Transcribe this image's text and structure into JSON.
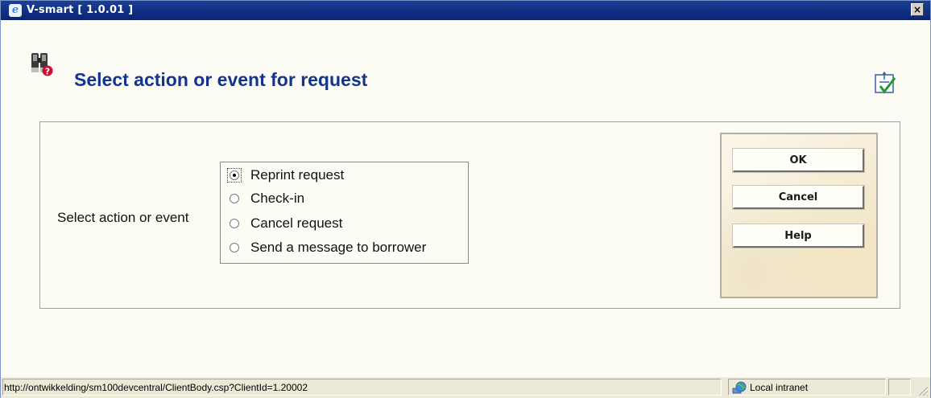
{
  "window": {
    "title": "V-smart [ 1.0.01 ]",
    "close_label": "×",
    "browser_icon_glyph": "e"
  },
  "page": {
    "title": "Select action or event for request",
    "header_icon": "binoculars-question-icon",
    "corner_icon": "form-check-icon"
  },
  "form": {
    "field_label": "Select action or event",
    "options": [
      {
        "label": "Reprint request",
        "selected": true
      },
      {
        "label": "Check-in",
        "selected": false
      },
      {
        "label": "Cancel request",
        "selected": false
      },
      {
        "label": "Send a message to borrower",
        "selected": false
      }
    ]
  },
  "buttons": {
    "ok": "OK",
    "cancel": "Cancel",
    "help": "Help"
  },
  "statusbar": {
    "url": "http://ontwikkelding/sm100devcentral/ClientBody.csp?ClientId=1.20002",
    "zone": "Local intranet",
    "zone_icon": "globe-intranet-icon"
  },
  "colors": {
    "title_bar": "#0a2470",
    "heading": "#13348e",
    "background": "#fdfcf4"
  }
}
